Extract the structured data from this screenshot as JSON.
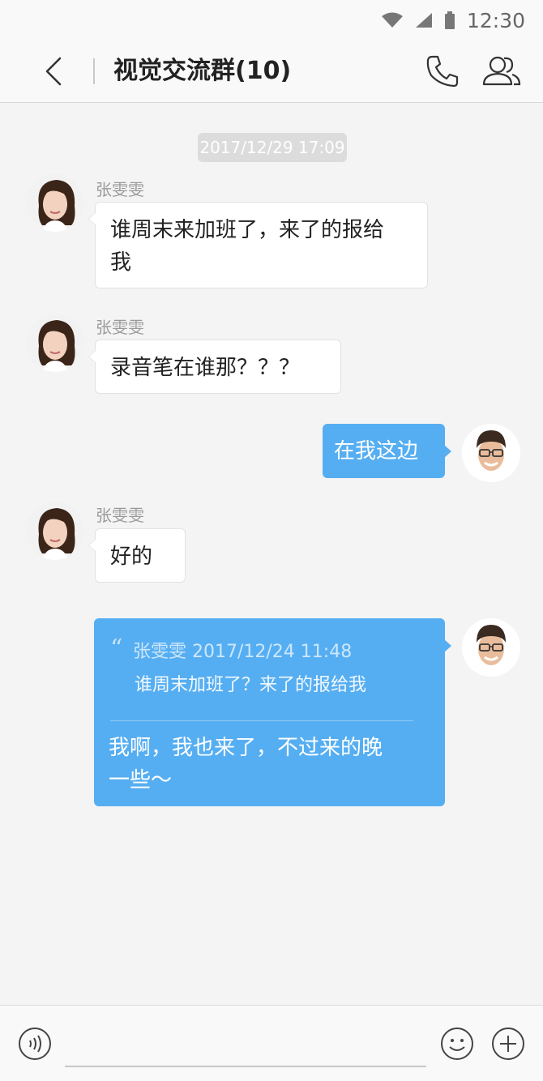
{
  "status_bar": {
    "time": "12:30",
    "icons": [
      "wifi-icon",
      "cellular-signal-icon",
      "battery-icon"
    ]
  },
  "nav": {
    "title": "视觉交流群(10)",
    "icons": [
      "back-arrow-icon",
      "phone-icon",
      "group-members-icon"
    ]
  },
  "timestamp": "2017/12/29 17:09",
  "messages": [
    {
      "direction": "incoming",
      "sender": "张雯雯",
      "text": "谁周末来加班了，来了的报给我",
      "line1": "谁周末来加班了，来了的报给",
      "line2": "我"
    },
    {
      "direction": "incoming",
      "sender": "张雯雯",
      "text": "录音笔在谁那？？？"
    },
    {
      "direction": "outgoing",
      "text": "在我这边"
    },
    {
      "direction": "incoming",
      "sender": "张雯雯",
      "text": "好的"
    },
    {
      "direction": "outgoing",
      "quote": {
        "sender": "张雯雯",
        "time": "2017/12/24 11:48",
        "meta": "张雯雯 2017/12/24 11:48",
        "text": "谁周末加班了？来了的报给我"
      },
      "text": "我啊，我也来了，不过来的晚一些～",
      "line1": "我啊，我也来了，不过来的晚",
      "line2": "一些～"
    }
  ],
  "input_bar": {
    "placeholder": "",
    "icons": [
      "voice-icon",
      "emoji-icon",
      "plus-icon"
    ]
  },
  "colors": {
    "outgoing_bubble": "#56aef2",
    "incoming_bubble": "#ffffff",
    "background": "#f4f4f4"
  }
}
